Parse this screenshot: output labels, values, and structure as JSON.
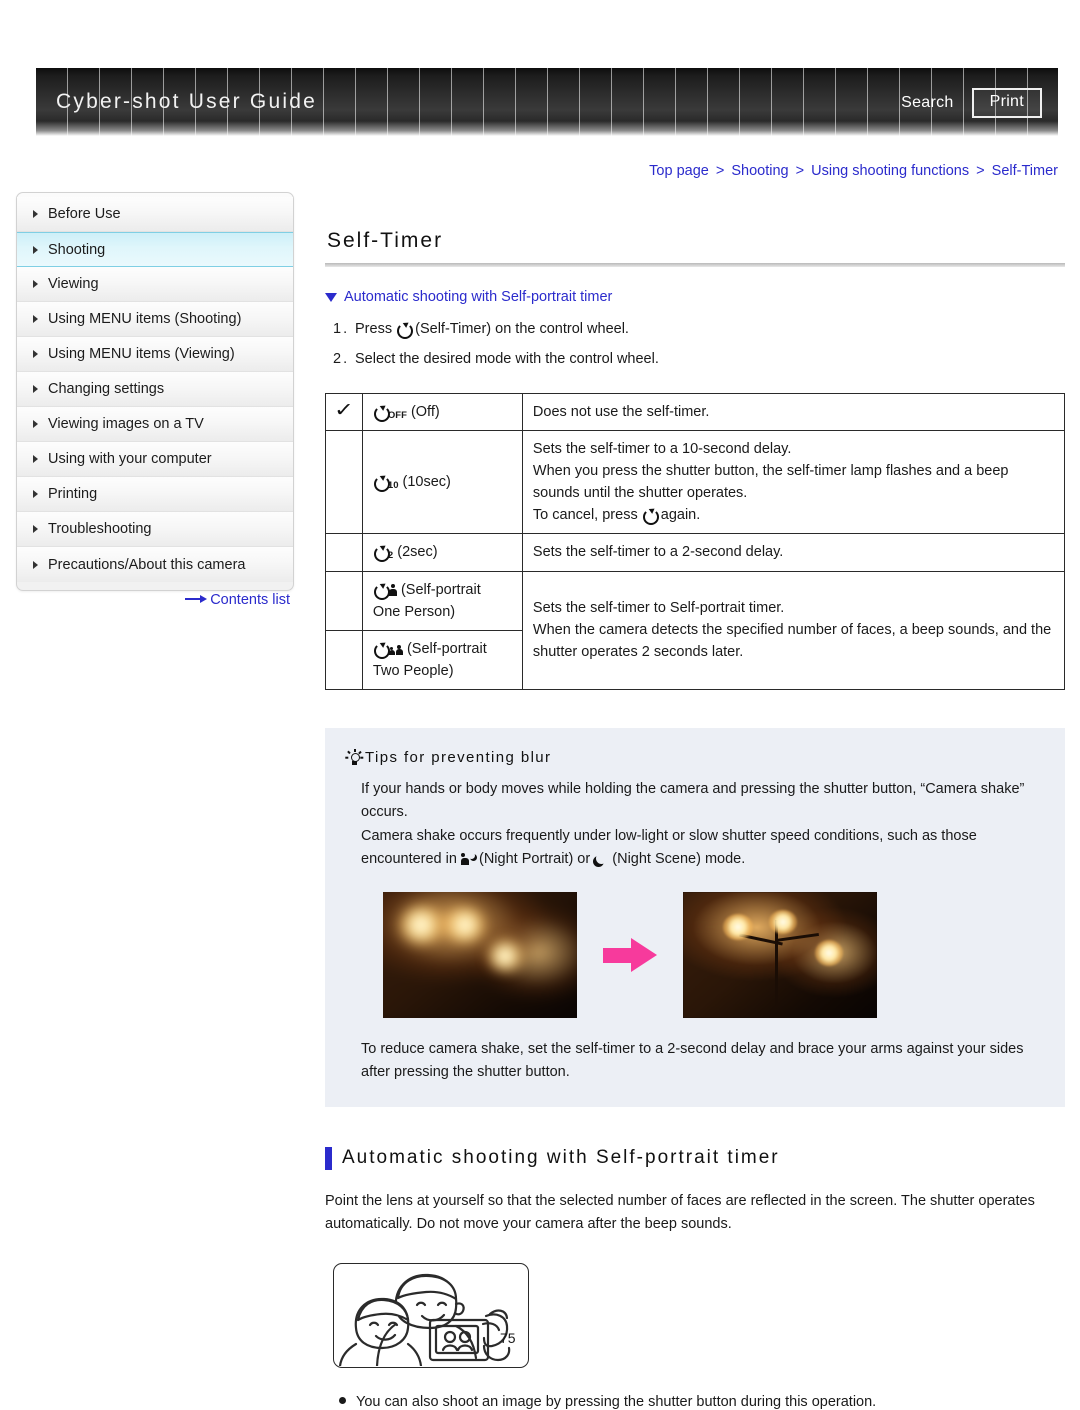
{
  "header": {
    "title": "Cyber-shot User Guide",
    "search_label": "Search",
    "print_label": "Print"
  },
  "breadcrumb": {
    "items": [
      "Top page",
      "Shooting",
      "Using shooting functions",
      "Self-Timer"
    ],
    "separator": ">"
  },
  "sidebar": {
    "items": [
      {
        "label": "Before Use",
        "active": false
      },
      {
        "label": "Shooting",
        "active": true
      },
      {
        "label": "Viewing",
        "active": false
      },
      {
        "label": "Using MENU items (Shooting)",
        "active": false
      },
      {
        "label": "Using MENU items (Viewing)",
        "active": false
      },
      {
        "label": "Changing settings",
        "active": false
      },
      {
        "label": "Viewing images on a TV",
        "active": false
      },
      {
        "label": "Using with your computer",
        "active": false
      },
      {
        "label": "Printing",
        "active": false
      },
      {
        "label": "Troubleshooting",
        "active": false
      },
      {
        "label": "Precautions/About this camera",
        "active": false
      }
    ],
    "contents_link": "Contents list"
  },
  "main": {
    "page_title": "Self-Timer",
    "anchor_link": "Automatic shooting with Self-portrait timer",
    "steps": [
      {
        "num": "1.",
        "before": "Press",
        "after": "(Self-Timer) on the control wheel."
      },
      {
        "num": "2.",
        "before": "Select the desired mode with the control wheel.",
        "after": ""
      }
    ],
    "table": {
      "rows": [
        {
          "checked": true,
          "mode_sub": "OFF",
          "mode_label": "(Off)",
          "desc_lines": [
            "Does not use the self-timer."
          ]
        },
        {
          "checked": false,
          "mode_sub": "10",
          "mode_label": "(10sec)",
          "desc_lines": [
            "Sets the self-timer to a 10-second delay.",
            "When you press the shutter button, the self-timer lamp flashes and a beep sounds until the shutter operates.",
            "To cancel, press  again."
          ]
        },
        {
          "checked": false,
          "mode_sub": "2",
          "mode_label": "(2sec)",
          "desc_lines": [
            "Sets the self-timer to a 2-second delay."
          ]
        },
        {
          "checked": false,
          "mode_sub": "",
          "mode_label": "(Self-portrait One Person)",
          "desc_lines": []
        },
        {
          "checked": false,
          "mode_sub": "",
          "mode_label": "(Self-portrait Two People)",
          "desc_lines": []
        }
      ],
      "merged_desc_lines": [
        "Sets the self-timer to Self-portrait timer.",
        "When the camera detects the specified number of faces, a beep sounds, and the shutter operates 2 seconds later."
      ]
    },
    "tips": {
      "title": "Tips for preventing blur",
      "para1": "If your hands or body moves while holding the camera and pressing the shutter button, “Camera shake” occurs.",
      "para2_before": "Camera shake occurs frequently under low-light or slow shutter speed conditions, such as those encountered in",
      "para2_mid": "(Night Portrait) or",
      "para2_after": "(Night Scene) mode.",
      "para3": "To reduce camera shake, set the self-timer to a 2-second delay and brace your arms against your sides after pressing the shutter button."
    },
    "section2": {
      "heading": "Automatic shooting with Self-portrait timer",
      "body": "Point the lens at yourself so that the selected number of faces are reflected in the screen. The shutter operates automatically. Do not move your camera after the beep sounds.",
      "note": "You can also shoot an image by pressing the shutter button during this operation."
    },
    "page_number": "75"
  },
  "colors": {
    "link": "#2b2bcc",
    "accent_bar": "#2b2bcc",
    "tips_bg": "#eceff5",
    "sidebar_active": "#cdeff8",
    "arrow_pink": "#f73a9c"
  }
}
